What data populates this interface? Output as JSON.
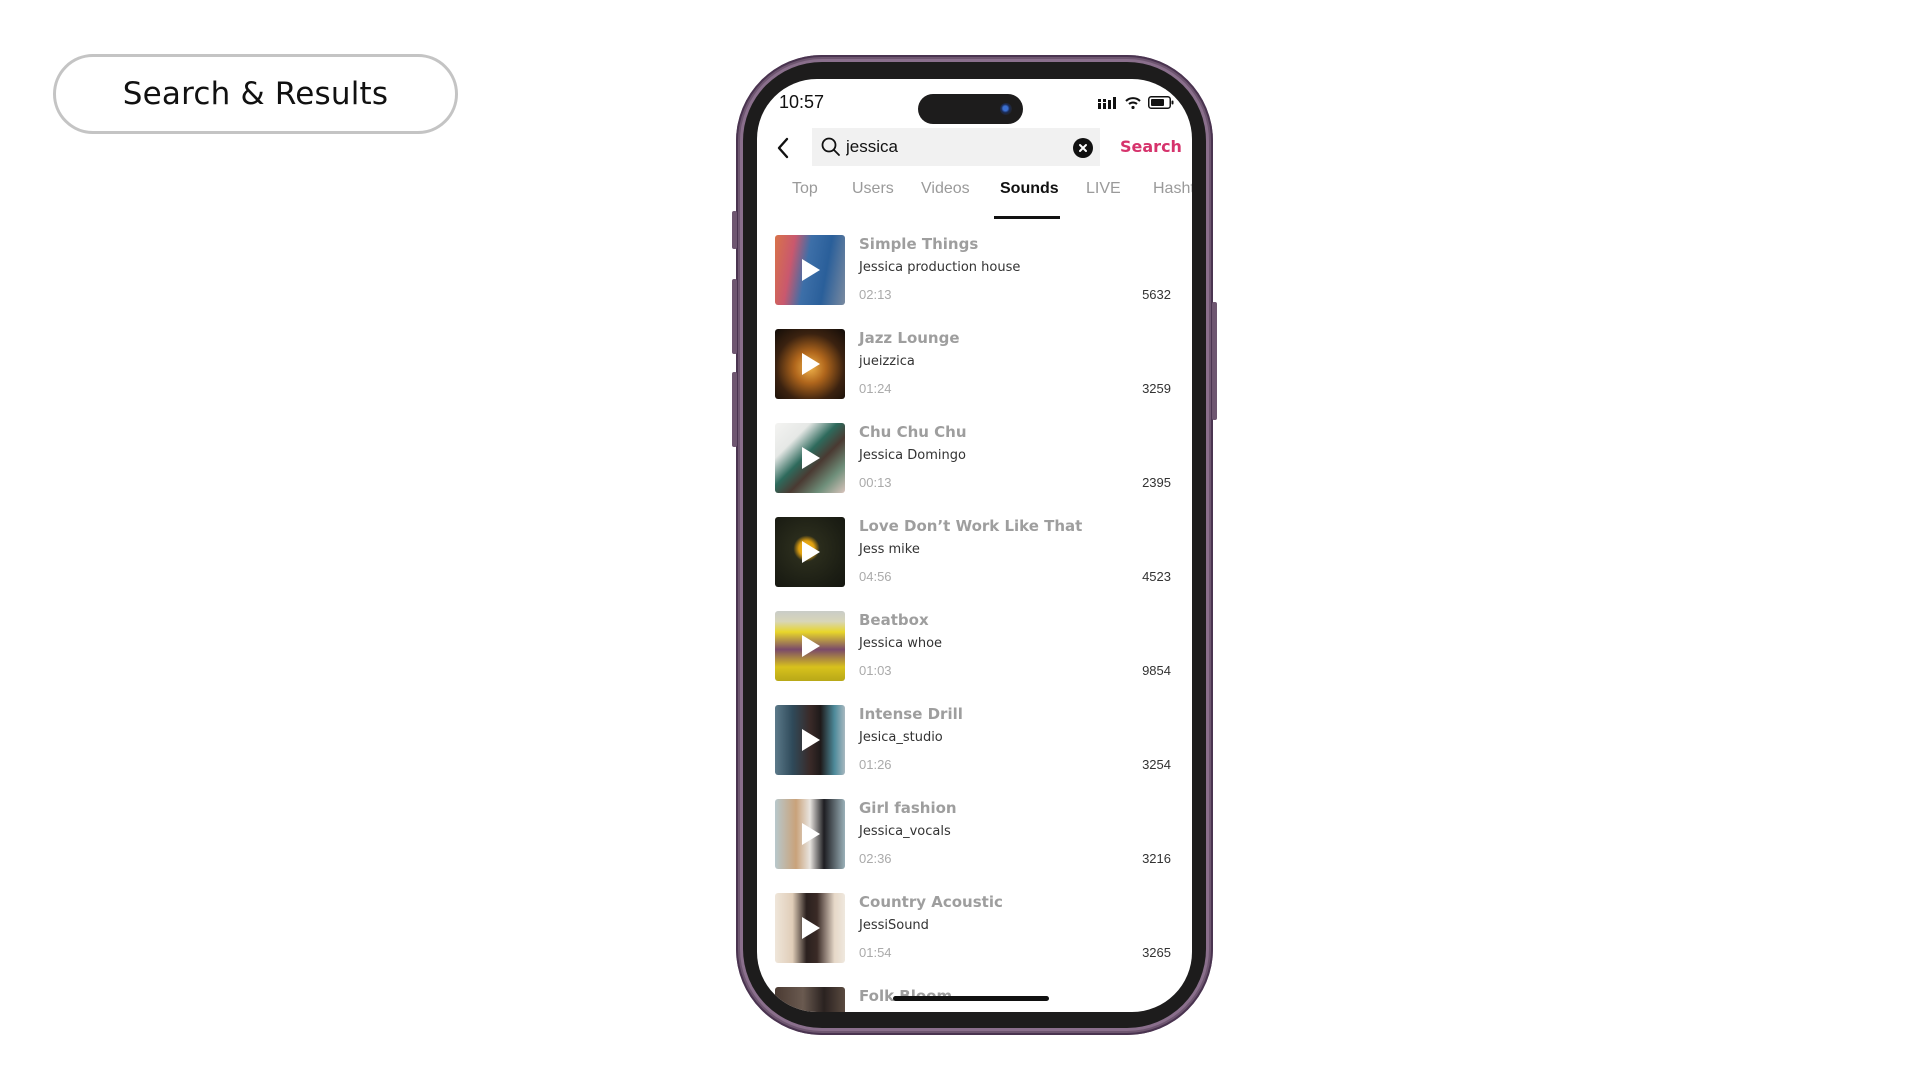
{
  "page_label": "Search & Results",
  "status_bar": {
    "time": "10:57"
  },
  "search": {
    "query": "jessica",
    "action_label": "Search"
  },
  "tabs": [
    {
      "label": "Top",
      "active": false
    },
    {
      "label": "Users",
      "active": false
    },
    {
      "label": "Videos",
      "active": false
    },
    {
      "label": "Sounds",
      "active": true
    },
    {
      "label": "LIVE",
      "active": false
    },
    {
      "label": "Hashtags",
      "active": false
    }
  ],
  "colors": {
    "accent": "#d6336c",
    "phone_frame": "#6e5670",
    "bezel": "#1d1c1c"
  },
  "sounds": [
    {
      "title": "Simple Things",
      "artist": "Jessica production house",
      "duration": "02:13",
      "count": "5632"
    },
    {
      "title": "Jazz Lounge",
      "artist": "jueizzica",
      "duration": "01:24",
      "count": "3259"
    },
    {
      "title": "Chu Chu Chu",
      "artist": "Jessica Domingo",
      "duration": "00:13",
      "count": "2395"
    },
    {
      "title": "Love Don’t Work Like That",
      "artist": "Jess mike",
      "duration": "04:56",
      "count": "4523"
    },
    {
      "title": "Beatbox",
      "artist": "Jessica whoe",
      "duration": "01:03",
      "count": "9854"
    },
    {
      "title": "Intense Drill",
      "artist": "Jesica_studio",
      "duration": "01:26",
      "count": "3254"
    },
    {
      "title": "Girl fashion",
      "artist": "Jessica_vocals",
      "duration": "02:36",
      "count": "3216"
    },
    {
      "title": "Country Acoustic",
      "artist": "JessiSound",
      "duration": "01:54",
      "count": "3265"
    },
    {
      "title": "Folk Bloom",
      "artist": "",
      "duration": "",
      "count": ""
    }
  ]
}
